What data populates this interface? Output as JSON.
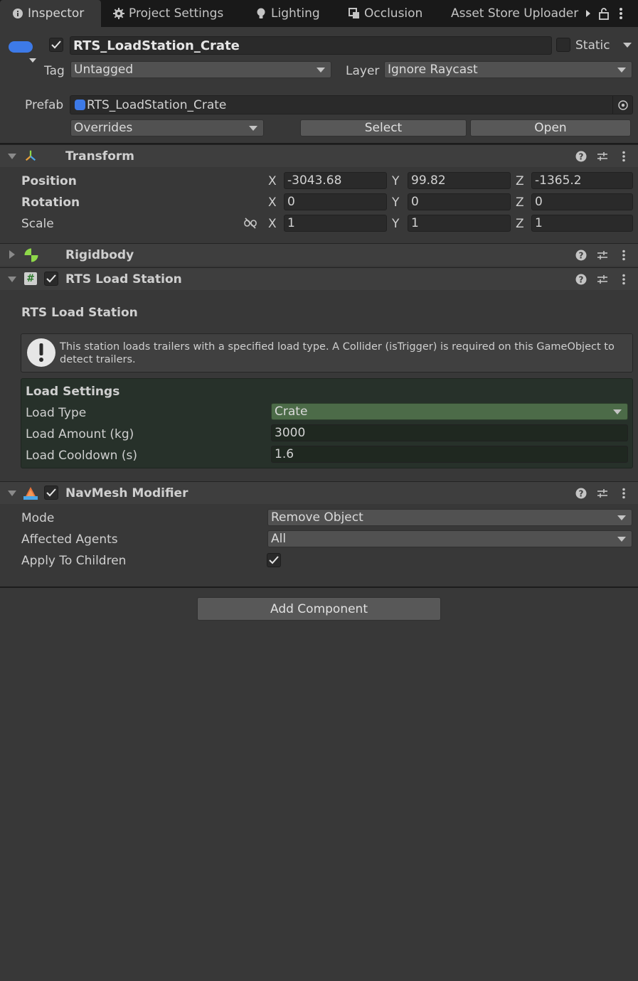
{
  "tabs": [
    {
      "label": "Inspector",
      "icon": "info-icon",
      "active": true
    },
    {
      "label": "Project Settings",
      "icon": "gear-icon",
      "active": false
    },
    {
      "label": "Lighting",
      "icon": "lightbulb-icon",
      "active": false
    },
    {
      "label": "Occlusion",
      "icon": "occlusion-icon",
      "active": false
    },
    {
      "label": "Asset Store Uploader",
      "icon": "",
      "active": false
    }
  ],
  "header": {
    "object_name": "RTS_LoadStation_Crate",
    "active": true,
    "static_label": "Static",
    "static_checked": false,
    "tag_label": "Tag",
    "tag_value": "Untagged",
    "layer_label": "Layer",
    "layer_value": "Ignore Raycast",
    "prefab_label": "Prefab",
    "prefab_value": "RTS_LoadStation_Crate",
    "overrides_label": "Overrides",
    "select_label": "Select",
    "open_label": "Open"
  },
  "transform": {
    "title": "Transform",
    "position_label": "Position",
    "rotation_label": "Rotation",
    "scale_label": "Scale",
    "x_label": "X",
    "y_label": "Y",
    "z_label": "Z",
    "position": {
      "x": "-3043.68",
      "y": "99.82",
      "z": "-1365.2"
    },
    "rotation": {
      "x": "0",
      "y": "0",
      "z": "0"
    },
    "scale": {
      "x": "1",
      "y": "1",
      "z": "1"
    }
  },
  "rigidbody": {
    "title": "Rigidbody"
  },
  "rts_load_station": {
    "title": "RTS Load Station",
    "enabled": true,
    "inner_title": "RTS Load Station",
    "help_text_line1": "This station loads trailers with a specified load type. A Collider (isTrigger) is required on this GameObject to",
    "help_text_line2": "detect trailers.",
    "settings_title": "Load Settings",
    "load_type_label": "Load Type",
    "load_type_value": "Crate",
    "load_amount_label": "Load Amount (kg)",
    "load_amount_value": "3000",
    "load_cooldown_label": "Load Cooldown (s)",
    "load_cooldown_value": "1.6"
  },
  "navmesh_modifier": {
    "title": "NavMesh Modifier",
    "enabled": true,
    "mode_label": "Mode",
    "mode_value": "Remove Object",
    "agents_label": "Affected Agents",
    "agents_value": "All",
    "children_label": "Apply To Children",
    "children_checked": true
  },
  "add_component_label": "Add Component",
  "colors": {
    "background": "#383838",
    "tabbar": "#191919",
    "prefab_blue": "#3d7ae8",
    "settings_bg": "#27312a",
    "load_type_green": "#4c6b48"
  }
}
